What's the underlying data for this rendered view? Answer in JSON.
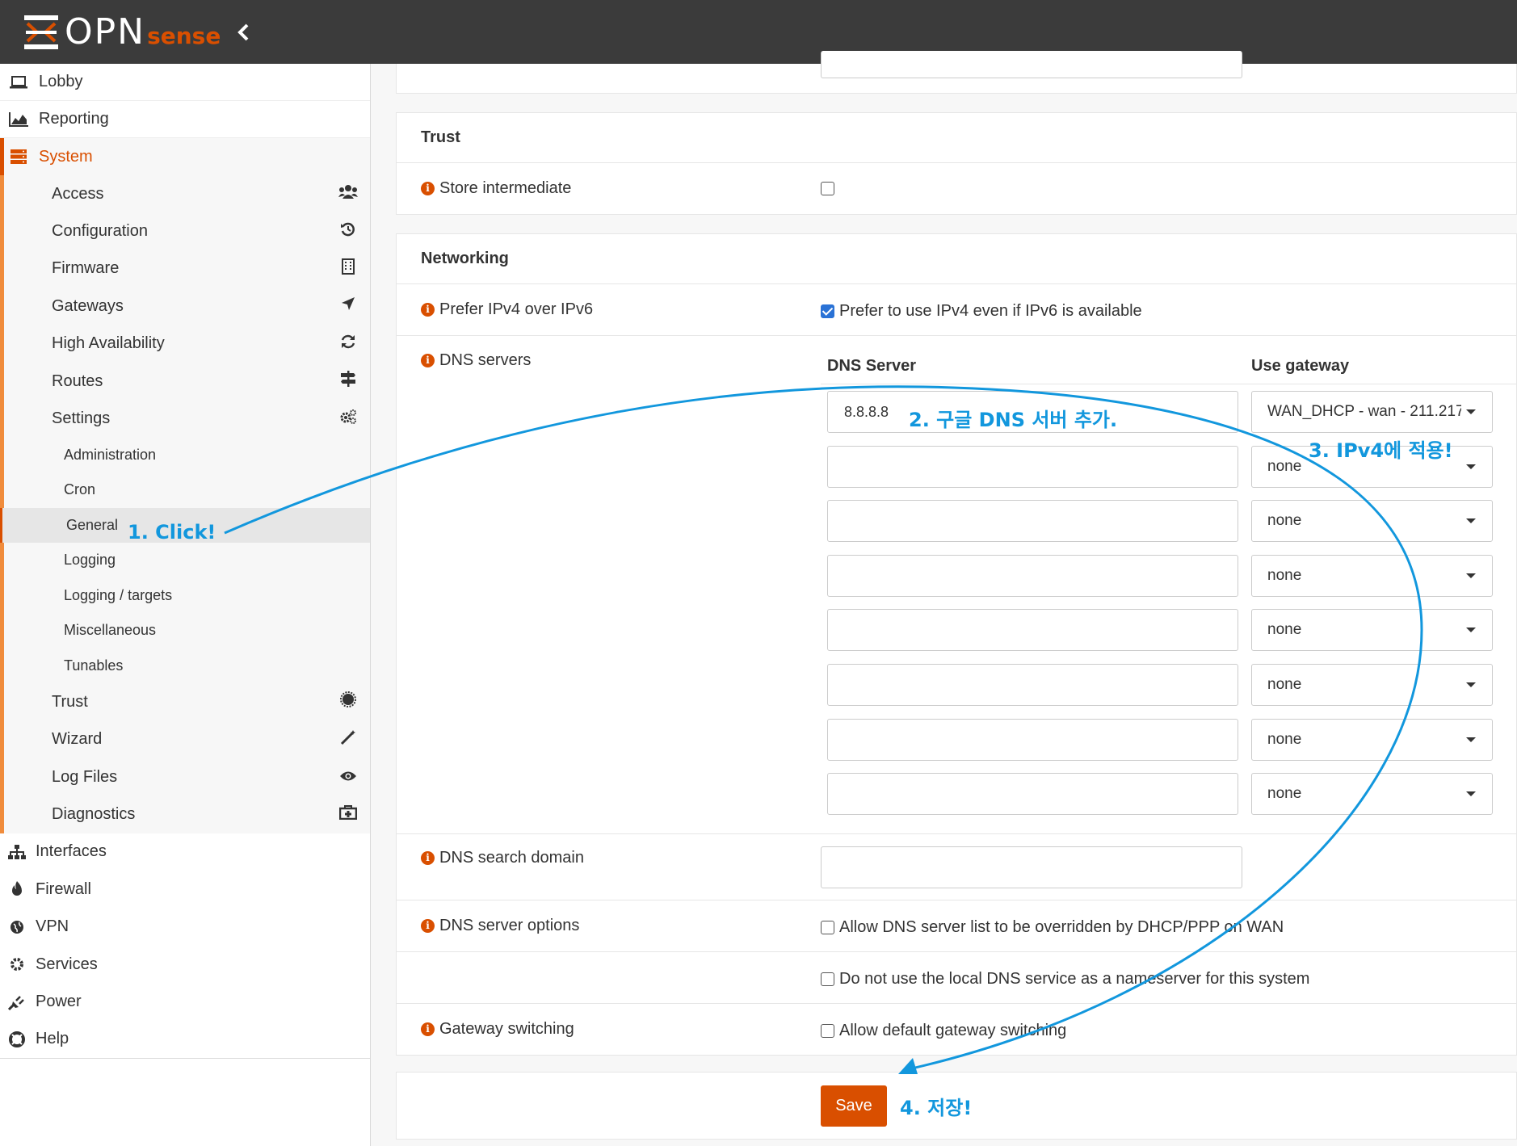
{
  "header": {
    "brand_main": "OPN",
    "brand_sub": "sense",
    "collapse_icon": "chevron-left-icon"
  },
  "sidebar": {
    "top": [
      {
        "label": "Lobby",
        "icon": "laptop-icon"
      },
      {
        "label": "Reporting",
        "icon": "area-chart-icon"
      }
    ],
    "system": {
      "label": "System",
      "icon": "server-icon"
    },
    "system_items": [
      {
        "label": "Access",
        "icon": "users-icon"
      },
      {
        "label": "Configuration",
        "icon": "history-icon"
      },
      {
        "label": "Firmware",
        "icon": "building-icon"
      },
      {
        "label": "Gateways",
        "icon": "location-arrow-icon"
      },
      {
        "label": "High Availability",
        "icon": "refresh-icon"
      },
      {
        "label": "Routes",
        "icon": "map-signs-icon"
      },
      {
        "label": "Settings",
        "icon": "cogs-icon"
      }
    ],
    "settings_items": [
      "Administration",
      "Cron",
      "General",
      "Logging",
      "Logging / targets",
      "Miscellaneous",
      "Tunables"
    ],
    "system_items2": [
      {
        "label": "Trust",
        "icon": "certificate-icon"
      },
      {
        "label": "Wizard",
        "icon": "magic-icon"
      },
      {
        "label": "Log Files",
        "icon": "eye-icon"
      },
      {
        "label": "Diagnostics",
        "icon": "medkit-icon"
      }
    ],
    "bottom": [
      {
        "label": "Interfaces",
        "icon": "sitemap-icon"
      },
      {
        "label": "Firewall",
        "icon": "fire-icon"
      },
      {
        "label": "VPN",
        "icon": "globe-icon"
      },
      {
        "label": "Services",
        "icon": "cog-icon"
      },
      {
        "label": "Power",
        "icon": "plug-icon"
      },
      {
        "label": "Help",
        "icon": "life-ring-icon"
      }
    ]
  },
  "main": {
    "trust": {
      "title": "Trust",
      "store_intermediate": "Store intermediate"
    },
    "networking": {
      "title": "Networking",
      "prefer_ipv4_label": "Prefer IPv4 over IPv6",
      "prefer_ipv4_text": "Prefer to use IPv4 even if IPv6 is available",
      "dns_servers_label": "DNS servers",
      "dns_server_header": "DNS Server",
      "use_gateway_header": "Use gateway",
      "dns_rows": [
        {
          "server": "8.8.8.8",
          "gateway": "WAN_DHCP - wan - 211.217."
        },
        {
          "server": "",
          "gateway": "none"
        },
        {
          "server": "",
          "gateway": "none"
        },
        {
          "server": "",
          "gateway": "none"
        },
        {
          "server": "",
          "gateway": "none"
        },
        {
          "server": "",
          "gateway": "none"
        },
        {
          "server": "",
          "gateway": "none"
        },
        {
          "server": "",
          "gateway": "none"
        }
      ],
      "dns_search_domain_label": "DNS search domain",
      "dns_server_options_label": "DNS server options",
      "dns_option1": "Allow DNS server list to be overridden by DHCP/PPP on WAN",
      "dns_option2": "Do not use the local DNS service as a nameserver for this system",
      "gateway_switching_label": "Gateway switching",
      "gateway_switching_text": "Allow default gateway switching"
    },
    "save_label": "Save"
  },
  "annotations": {
    "step1": "1. Click!",
    "step2": "2. 구글 DNS 서버 추가.",
    "step3": "3. IPv4에 적용!",
    "step4": "4. 저장!",
    "color": "#1297dd"
  },
  "colors": {
    "accent": "#d94f00",
    "header_bg": "#3b3b3b",
    "checkbox": "#2a72d6"
  }
}
